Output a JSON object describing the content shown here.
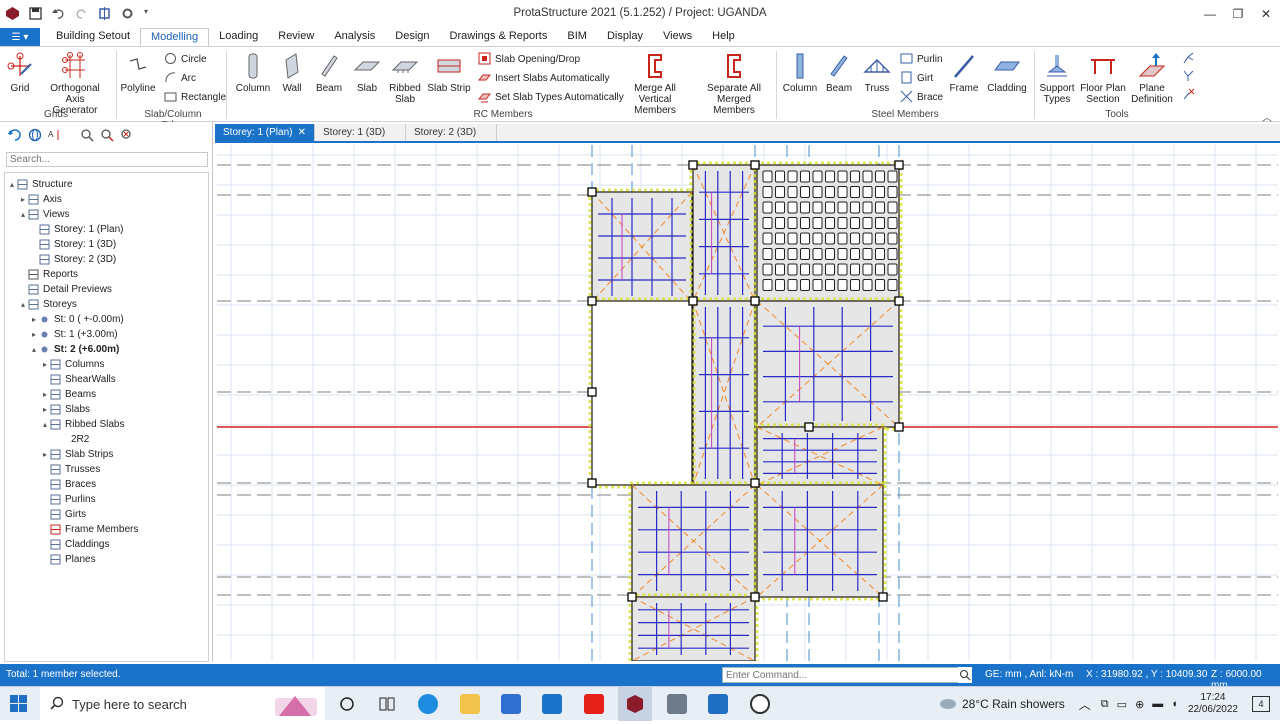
{
  "window": {
    "title": "ProtaStructure 2021 (5.1.252) / Project: UGANDA",
    "controls": [
      "—",
      "❐",
      "✕"
    ]
  },
  "ribbon_tabs": [
    "Building Setout",
    "Modelling",
    "Loading",
    "Review",
    "Analysis",
    "Design",
    "Drawings & Reports",
    "BIM",
    "Display",
    "Views",
    "Help"
  ],
  "ribbon": {
    "grid": "Grid",
    "orthogonal": "Orthogonal",
    "axis_generator": "Axis Generator",
    "grids_label": "Grids",
    "polyline": "Polyline",
    "circle": "Circle",
    "arc": "Arc",
    "rectangle": "Rectangle",
    "slab_edge_label": "Slab/Column Edge",
    "column": "Column",
    "wall": "Wall",
    "beam": "Beam",
    "slab": "Slab",
    "ribbed": "Ribbed",
    "ribbed_slab": "Slab",
    "slab_strip": "Slab Strip",
    "slab_opening": "Slab Opening/Drop",
    "insert_slabs": "Insert Slabs Automatically",
    "set_slab_types": "Set Slab Types Automatically",
    "merge_all": "Merge All",
    "vertical_members": "Vertical Members",
    "separate_all": "Separate All",
    "merged_members": "Merged Members",
    "rc_label": "RC Members",
    "s_column": "Column",
    "s_beam": "Beam",
    "truss": "Truss",
    "purlin": "Purlin",
    "girt": "Girt",
    "brace": "Brace",
    "frame": "Frame",
    "cladding": "Cladding",
    "steel_label": "Steel Members",
    "support": "Support",
    "types": "Types",
    "floor_plan": "Floor Plan",
    "section": "Section",
    "plane": "Plane",
    "definition": "Definition",
    "tools_label": "Tools",
    "colors": {
      "accent": "#1a73c9",
      "red": "#c8261c"
    }
  },
  "tree": {
    "search_placeholder": "Search...",
    "items": [
      {
        "label": "Structure",
        "icon": "structure-icon"
      },
      {
        "label": "Axis",
        "icon": "axis-icon"
      },
      {
        "label": "Views",
        "icon": "views-icon"
      },
      {
        "label": "Storey: 1 (Plan)",
        "icon": "plan-view-icon"
      },
      {
        "label": "Storey: 1 (3D)",
        "icon": "3d-view-icon"
      },
      {
        "label": "Storey: 2 (3D)",
        "icon": "3d-view-icon"
      },
      {
        "label": "Reports",
        "icon": "printer-icon"
      },
      {
        "label": "Detail Previews",
        "icon": "detail-preview-icon"
      },
      {
        "label": "Storeys",
        "icon": "storeys-icon"
      },
      {
        "label": "St: 0 ( +-0.00m)",
        "icon": "storey-dot-icon"
      },
      {
        "label": "St: 1 (+3.00m)",
        "icon": "storey-dot-icon"
      },
      {
        "label": "St: 2 (+6.00m)",
        "icon": "storey-dot-icon"
      },
      {
        "label": "Columns",
        "icon": "columns-icon"
      },
      {
        "label": "ShearWalls",
        "icon": "shearwalls-icon"
      },
      {
        "label": "Beams",
        "icon": "beams-icon"
      },
      {
        "label": "Slabs",
        "icon": "slabs-icon"
      },
      {
        "label": "Ribbed Slabs",
        "icon": "ribbed-slabs-icon"
      },
      {
        "label": "2R2",
        "icon": ""
      },
      {
        "label": "Slab Strips",
        "icon": "slab-strips-icon"
      },
      {
        "label": "Trusses",
        "icon": "trusses-icon"
      },
      {
        "label": "Braces",
        "icon": "braces-icon"
      },
      {
        "label": "Purlins",
        "icon": "purlins-icon"
      },
      {
        "label": "Girts",
        "icon": "girts-icon"
      },
      {
        "label": "Frame Members",
        "icon": "frame-members-icon"
      },
      {
        "label": "Claddings",
        "icon": "claddings-icon"
      },
      {
        "label": "Planes",
        "icon": "planes-icon"
      }
    ]
  },
  "doc_tabs": [
    "Storey: 1 (Plan)",
    "Storey: 1 (3D)",
    "Storey: 2 (3D)"
  ],
  "doc_tab_close": "✕",
  "status": {
    "selection": "Total: 1 member selected.",
    "command_placeholder": "Enter Command...",
    "units": "GE: mm , Anl: kN-m",
    "coords": "X : 31980.92 , Y : 10409.30",
    "z": "Z : 6000.00 mm"
  },
  "taskbar": {
    "search": "Type here to search",
    "weather": "28°C  Rain showers",
    "time": "17:24",
    "date": "22/06/2022",
    "notifications": "4"
  }
}
